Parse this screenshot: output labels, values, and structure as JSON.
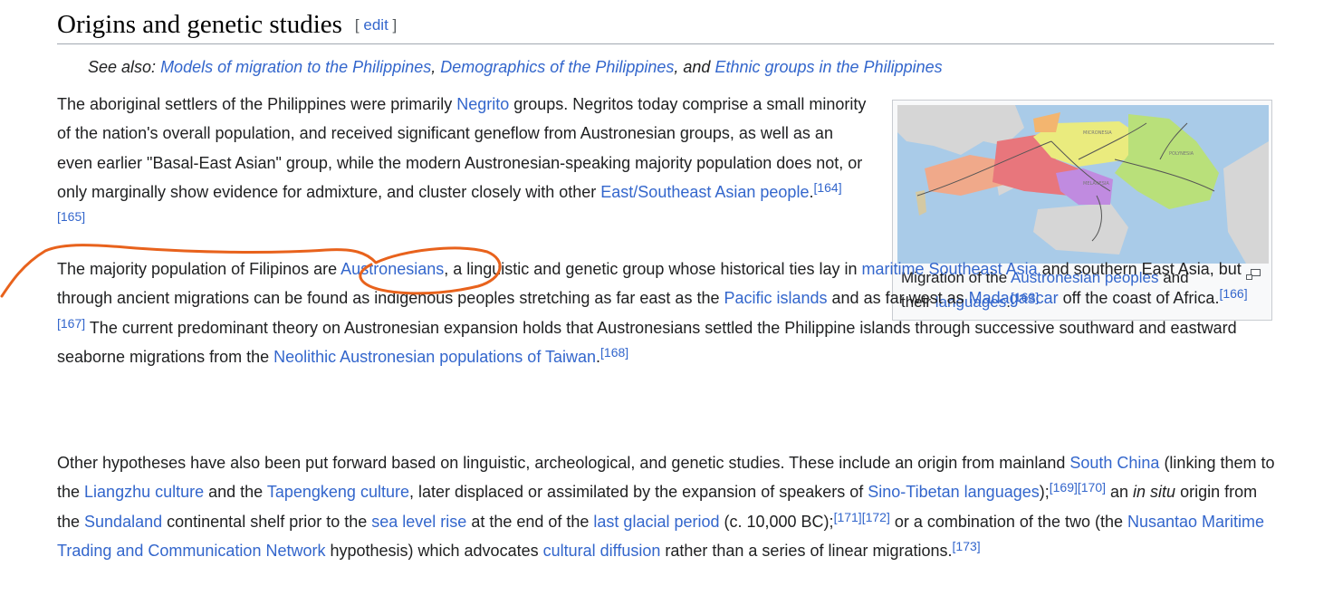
{
  "heading": {
    "title": "Origins and genetic studies",
    "edit_open": "[",
    "edit_label": "edit",
    "edit_close": "]"
  },
  "hatnote": {
    "prefix": "See also: ",
    "link1": "Models of migration to the Philippines",
    "sep1": ", ",
    "link2": "Demographics of the Philippines",
    "sep2": ", and ",
    "link3": "Ethnic groups in the Philippines"
  },
  "p1": {
    "t1": "The aboriginal settlers of the Philippines were primarily ",
    "l1": "Negrito",
    "t2": " groups. Negritos today comprise a small minority of the nation's overall population, and received significant geneflow from Austronesian groups, as well as an even earlier \"Basal-East Asian\" group, while the modern Austronesian-speaking majority population does not, or only marginally show evidence for admixture, and cluster closely with other ",
    "l2": "East/Southeast Asian people",
    "t3": ".",
    "r1": "[164]",
    "r2": "[165]"
  },
  "p2": {
    "t1": "The majority population of Filipinos are ",
    "l1": "Austronesians",
    "t2": ", a linguistic and genetic group whose historical ties lay in ",
    "l2": "maritime Southeast Asia",
    "t3": " and southern East Asia, but through ancient migrations can be found as indigenous peoples stretching as far east as the ",
    "l3": "Pacific islands",
    "t4": " and as far west as ",
    "l4": "Madagascar",
    "t5": " off the coast of Africa.",
    "r1": "[166]",
    "r2": "[167]",
    "t6": " The current predominant theory on Austronesian expansion holds that Austronesians settled the Philippine islands through successive southward and eastward seaborne migrations from the ",
    "l5": "Neolithic Austronesian populations of Taiwan",
    "t7": ".",
    "r3": "[168]"
  },
  "p3": {
    "t1": "Other hypotheses have also been put forward based on linguistic, archeological, and genetic studies. These include an origin from mainland ",
    "l1": "South China",
    "t2": " (linking them to the ",
    "l2": "Liangzhu culture",
    "t3": " and the ",
    "l3": "Tapengkeng culture",
    "t4": ", later displaced or assimilated by the expansion of speakers of ",
    "l4": "Sino-Tibetan languages",
    "t5": ");",
    "r1": "[169]",
    "r2": "[170]",
    "t6": " an ",
    "em": "in situ",
    "t7": " origin from the ",
    "l5": "Sundaland",
    "t8": " continental shelf prior to the ",
    "l6": "sea level rise",
    "t9": " at the end of the ",
    "l7": "last glacial period",
    "t10": " (c. 10,000 BC);",
    "r3": "[171]",
    "r4": "[172]",
    "t11": " or a combination of the two (the ",
    "l8": "Nusantao Maritime Trading and Communication Network",
    "t12": " hypothesis) which advocates ",
    "l9": "cultural diffusion",
    "t13": " rather than a series of linear migrations.",
    "r5": "[173]"
  },
  "figure": {
    "caption_t1": "Migration of the ",
    "caption_l1": "Austronesian peoples",
    "caption_t2": " and their ",
    "caption_l2": "languages",
    "caption_t3": ".",
    "caption_ref": "[163]",
    "map_label_micronesia": "MICRONESIA",
    "map_label_polynesia": "POLYNESIA",
    "map_label_melanesia": "MELANESIA",
    "expand_icon": "magnify-clip-icon"
  },
  "colors": {
    "link": "#3366cc",
    "text": "#202122",
    "annotation": "#e8621c",
    "ocean": "#a9cbe8",
    "land": "#d9d9d9"
  }
}
